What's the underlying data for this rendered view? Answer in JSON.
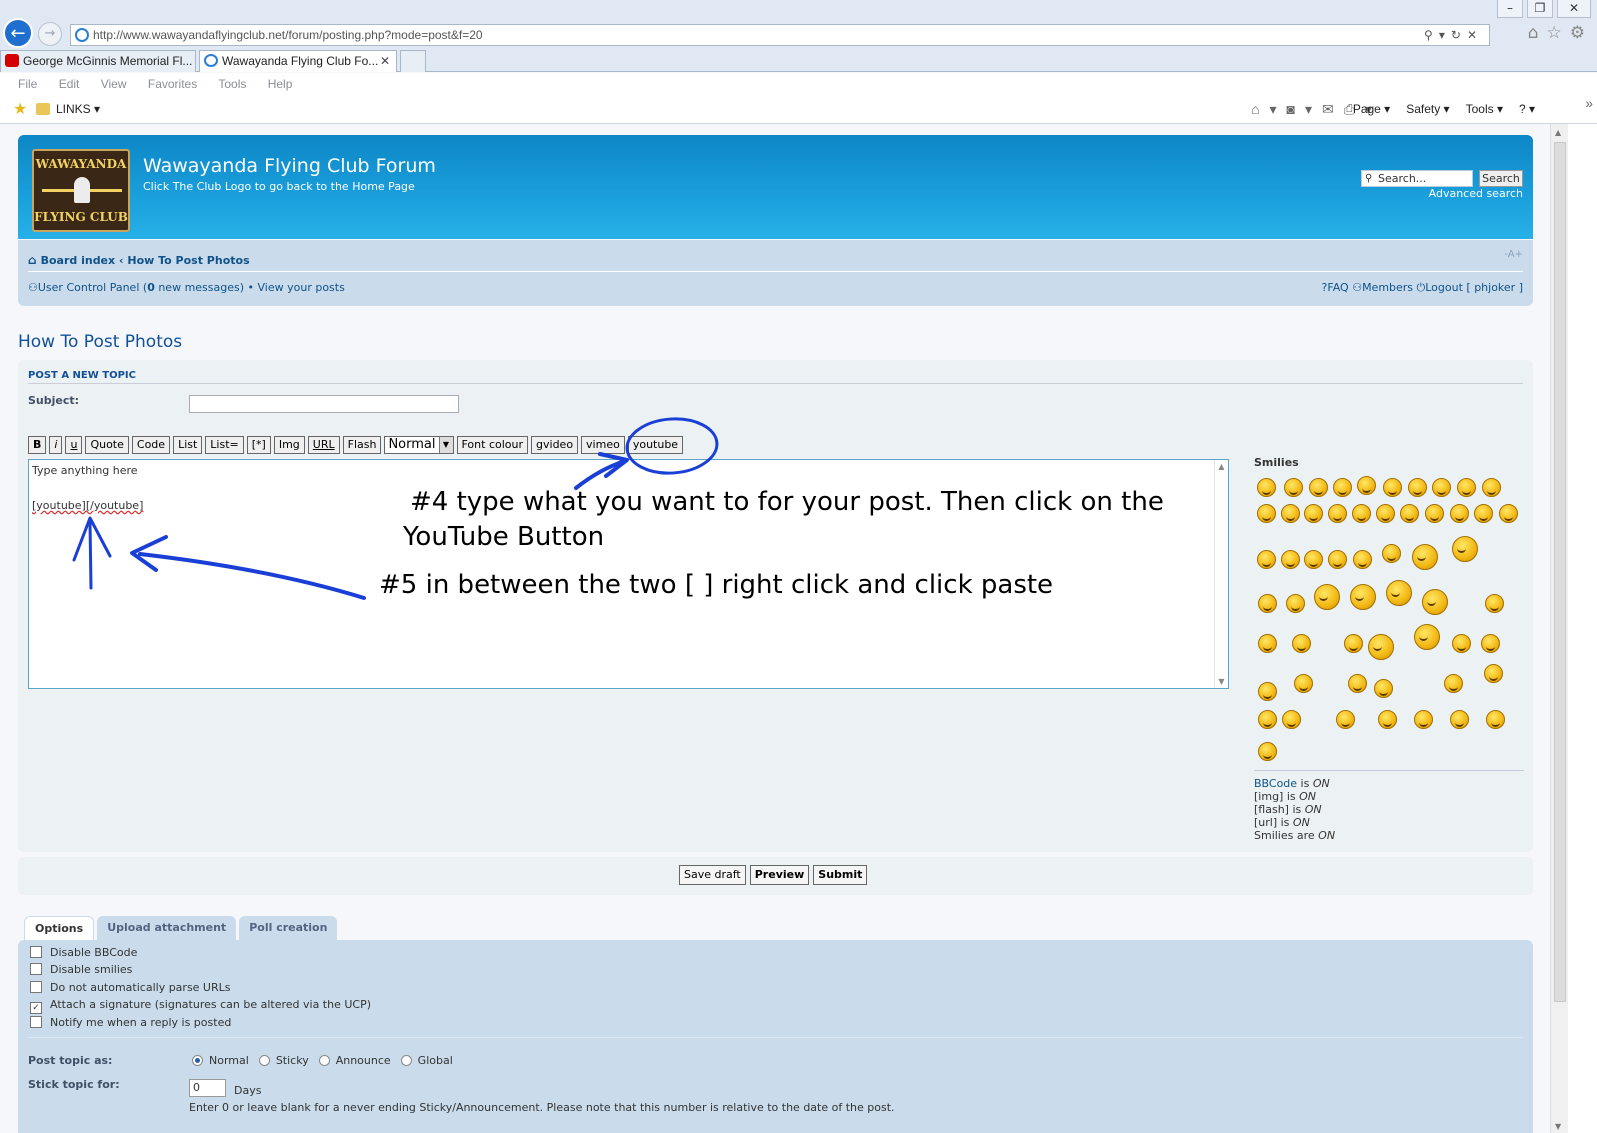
{
  "window": {
    "minimize": "–",
    "restore": "❐",
    "close": "✕"
  },
  "browser": {
    "url": "http://www.wawayandaflyingclub.net/forum/posting.php?mode=post&f=20",
    "tabs": [
      {
        "label": "George McGinnis Memorial Fl...",
        "icon": "youtube-icon"
      },
      {
        "label": "Wawayanda Flying Club Fo...",
        "icon": "ie-icon"
      }
    ],
    "menu": [
      "File",
      "Edit",
      "View",
      "Favorites",
      "Tools",
      "Help"
    ],
    "favorites_folder": "LINKS ▾",
    "commands": [
      "Page ▾",
      "Safety ▾",
      "Tools ▾",
      "? ▾"
    ]
  },
  "header": {
    "logo_top": "WAWAYANDA",
    "logo_bottom": "FLYING CLUB",
    "title": "Wawayanda Flying Club Forum",
    "description": "Click The Club Logo to go back to the Home Page",
    "search_placeholder": "Search...",
    "search_button": "Search",
    "advanced_search": "Advanced search"
  },
  "nav": {
    "board_index": "Board index",
    "separator": "‹",
    "forum": "How To Post Photos",
    "font_size": "-A+",
    "ucp": "User Control Panel",
    "messages_prefix": " (",
    "messages_count": "0",
    "messages_suffix": " new messages) • ",
    "view_posts": "View your posts",
    "faq": "FAQ",
    "members": "Members",
    "logout": "Logout [ phjoker ]"
  },
  "page": {
    "title": "How To Post Photos"
  },
  "post": {
    "heading": "Post a new topic",
    "subject_label": "Subject:",
    "subject_value": "",
    "toolbar": [
      "B",
      "i",
      "u",
      "Quote",
      "Code",
      "List",
      "List=",
      "[*]",
      "Img",
      "URL",
      "Flash"
    ],
    "font_size_value": "Normal",
    "toolbar_after": [
      "Font colour",
      "gvideo",
      "vimeo",
      "youtube"
    ],
    "message_line1": "Type anything here",
    "message_line2": "[youtube][/youtube]",
    "smilies_label": "Smilies",
    "status": {
      "bbcode_link": "BBCode",
      "bbcode_state": "ON",
      "img": "[img] is ",
      "img_state": "ON",
      "flash": "[flash] is ",
      "flash_state": "ON",
      "url": "[url] is ",
      "url_state": "ON",
      "smilies": "Smilies are ",
      "smilies_state": "ON",
      "is": " is "
    }
  },
  "actions": {
    "save_draft": "Save draft",
    "preview": "Preview",
    "submit": "Submit"
  },
  "options": {
    "tabs": [
      "Options",
      "Upload attachment",
      "Poll creation"
    ],
    "checkboxes": [
      {
        "label": "Disable BBCode",
        "checked": false
      },
      {
        "label": "Disable smilies",
        "checked": false
      },
      {
        "label": "Do not automatically parse URLs",
        "checked": false
      },
      {
        "label": "Attach a signature (signatures can be altered via the UCP)",
        "checked": true
      },
      {
        "label": "Notify me when a reply is posted",
        "checked": false
      }
    ],
    "post_type_label": "Post topic as:",
    "post_types": [
      "Normal",
      "Sticky",
      "Announce",
      "Global"
    ],
    "post_type_selected": "Normal",
    "stick_label": "Stick topic for:",
    "stick_value": "0",
    "stick_unit": "Days",
    "stick_note": "Enter 0 or leave blank for a never ending Sticky/Announcement. Please note that this number is relative to the date of the post."
  },
  "annotations": {
    "step4_line1": "#4 type what you want to for your post. Then click on the",
    "step4_line2": "YouTube Button",
    "step5": "#5 in between the two [ ] right click and click paste",
    "ink_color": "#1a3fd6"
  }
}
